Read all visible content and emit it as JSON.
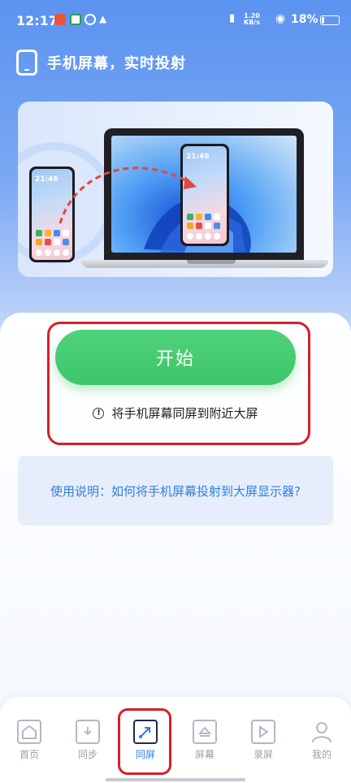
{
  "status_bar": {
    "time": "12:17",
    "net_speed_value": "1.20",
    "net_speed_unit": "KB/s",
    "battery": "18%",
    "battery_level": 0.18
  },
  "header": {
    "title": "手机屏幕，实时投射"
  },
  "banner": {
    "phone_left_time": "21:46",
    "phone_right_time": "21:46"
  },
  "actions": {
    "start_label": "开始",
    "hint_icon": "!",
    "hint_text": "将手机屏幕同屏到附近大屏"
  },
  "guide": {
    "text": "使用说明：如何将手机屏幕投射到大屏显示器?"
  },
  "nav": {
    "items": [
      {
        "label": "首页",
        "icon": "home-icon"
      },
      {
        "label": "同步",
        "icon": "folder-download-icon"
      },
      {
        "label": "同屏",
        "icon": "cast-arrow-icon",
        "active": true
      },
      {
        "label": "屏幕",
        "icon": "eject-icon"
      },
      {
        "label": "录屏",
        "icon": "play-icon"
      },
      {
        "label": "我的",
        "icon": "user-icon"
      }
    ]
  },
  "colors": {
    "accent_green": "#3ec66a",
    "accent_blue": "#2f7fe0",
    "highlight_red": "#d71f2a"
  }
}
